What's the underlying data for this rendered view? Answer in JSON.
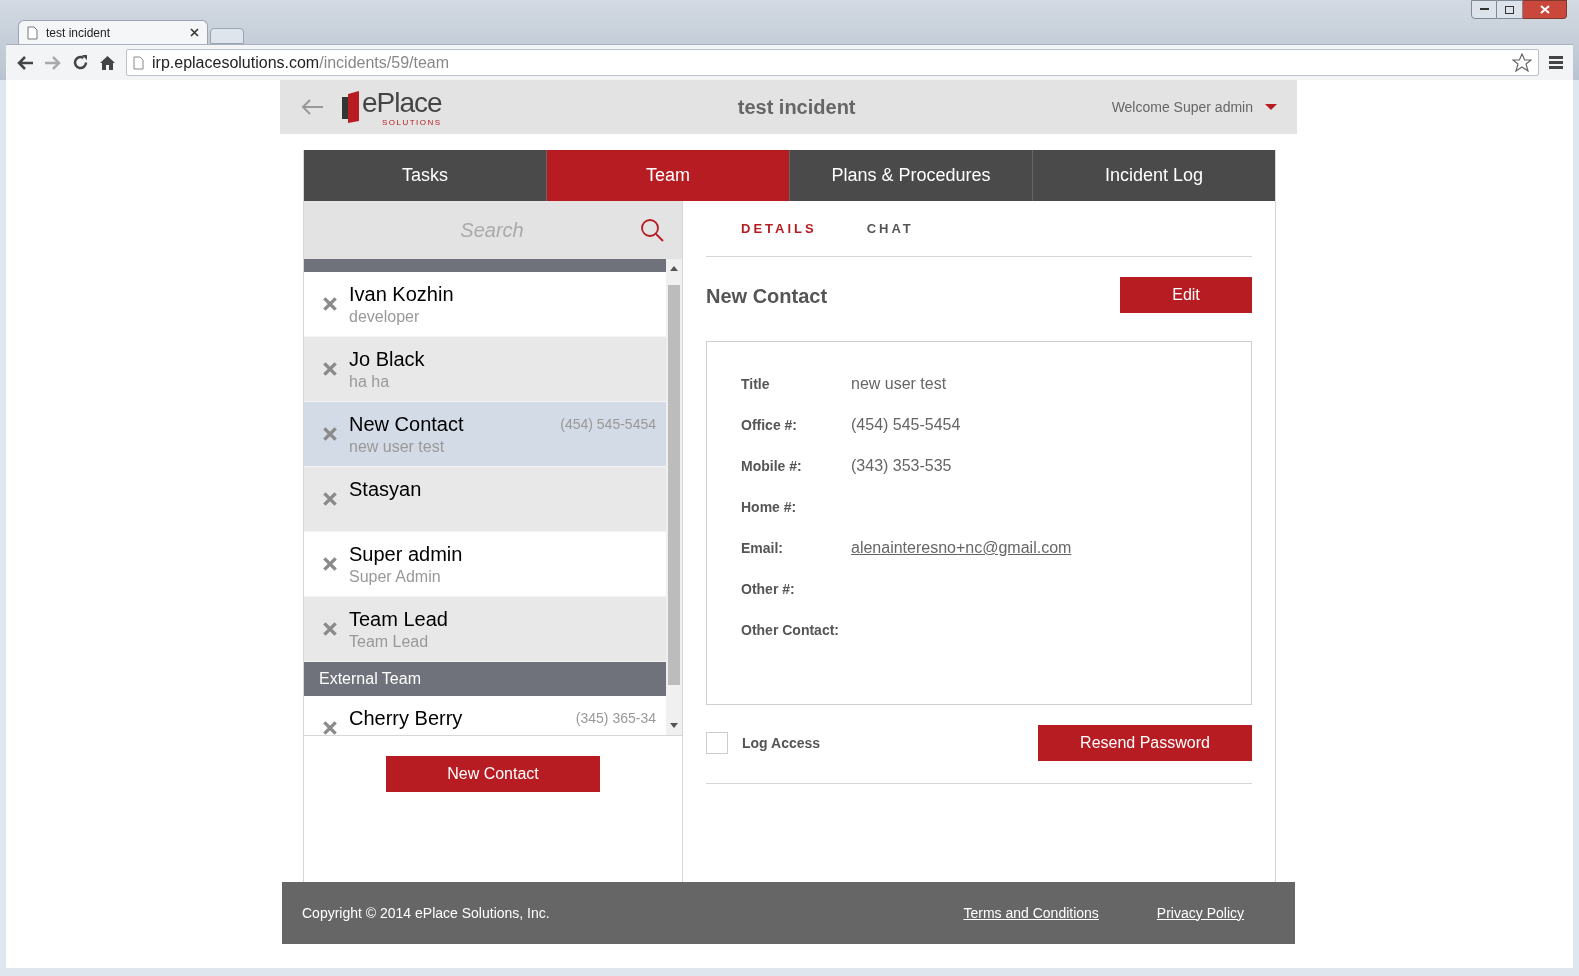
{
  "browser": {
    "tab_title": "test incident",
    "url_host": "irp.eplacesolutions.com",
    "url_path": "/incidents/59/team"
  },
  "header": {
    "logo_main": "ePlace",
    "logo_sub": "SOLUTIONS",
    "title": "test incident",
    "welcome": "Welcome Super admin"
  },
  "nav_tabs": [
    {
      "label": "Tasks",
      "selected": false
    },
    {
      "label": "Team",
      "selected": true
    },
    {
      "label": "Plans & Procedures",
      "selected": false
    },
    {
      "label": "Incident Log",
      "selected": false
    }
  ],
  "search": {
    "placeholder": "Search"
  },
  "groups": [
    {
      "contacts": [
        {
          "name": "Ivan Kozhin",
          "role": "developer",
          "selected": false
        },
        {
          "name": "Jo Black",
          "role": "ha ha",
          "selected": false
        },
        {
          "name": "New Contact",
          "role": "new user test",
          "phone": "(454) 545-5454",
          "selected": true
        },
        {
          "name": "Stasyan",
          "selected": false
        },
        {
          "name": "Super admin",
          "role": "Super Admin",
          "selected": false
        },
        {
          "name": "Team Lead",
          "role": "Team Lead",
          "selected": false
        }
      ]
    },
    {
      "label": "External Team",
      "contacts": [
        {
          "name": "Cherry Berry",
          "phone": "(345) 365-34",
          "selected": false
        }
      ]
    }
  ],
  "new_contact_button": "New Contact",
  "detail_tabs": [
    {
      "label": "DETAILS",
      "selected": true
    },
    {
      "label": "CHAT",
      "selected": false
    }
  ],
  "detail": {
    "heading": "New Contact",
    "edit_button": "Edit",
    "fields": [
      {
        "label": "Title",
        "value": "new user test"
      },
      {
        "label": "Office #:",
        "value": "(454) 545-5454"
      },
      {
        "label": "Mobile #:",
        "value": "(343) 353-535"
      },
      {
        "label": "Home #:"
      },
      {
        "label": "Email:",
        "value": "alenainteresno+nc@gmail.com",
        "kind": "link"
      },
      {
        "label": "Other #:"
      },
      {
        "label": "Other Contact:"
      }
    ],
    "log_access": {
      "label": "Log Access",
      "checked": false
    },
    "resend_button": "Resend Password"
  },
  "footer": {
    "copyright": "Copyright © 2014 ePlace Solutions, Inc.",
    "links": [
      "Terms and Conditions",
      "Privacy Policy"
    ]
  }
}
